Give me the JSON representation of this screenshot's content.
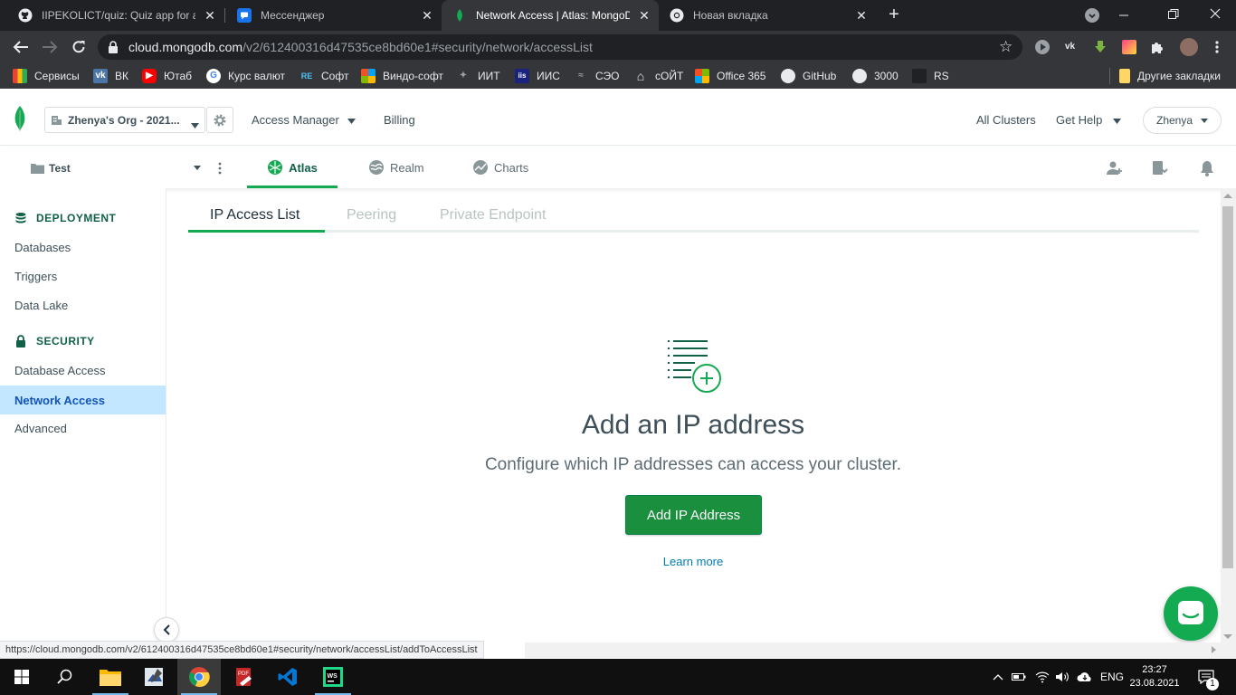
{
  "browser": {
    "tabs": [
      {
        "title": "IIPEKOLICT/quiz: Quiz app for and",
        "icon": "github-icon"
      },
      {
        "title": "Мессенджер",
        "icon": "messenger-icon"
      },
      {
        "title": "Network Access | Atlas: MongoDB",
        "icon": "mongodb-leaf-icon",
        "active": true
      },
      {
        "title": "Новая вкладка",
        "icon": "chrome-icon"
      }
    ],
    "url_host": "cloud.mongodb.com",
    "url_path": "/v2/612400316d47535ce8bd60e1#security/network/accessList",
    "bookmarks": [
      "Сервисы",
      "ВК",
      "Ютаб",
      "Курс валют",
      "Софт",
      "Виндо-софт",
      "ИИТ",
      "ИИС",
      "СЭО",
      "сОЙТ",
      "Office 365",
      "GitHub",
      "3000",
      "RS"
    ],
    "other_bookmarks": "Другие закладки"
  },
  "atlas": {
    "org": "Zhenya's Org - 2021...",
    "access_manager": "Access Manager",
    "billing": "Billing",
    "all_clusters": "All Clusters",
    "get_help": "Get Help",
    "user": "Zhenya",
    "project": "Test",
    "product_tabs": [
      "Atlas",
      "Realm",
      "Charts"
    ]
  },
  "sidebar": {
    "deployment": "DEPLOYMENT",
    "deployment_items": [
      "Databases",
      "Triggers",
      "Data Lake"
    ],
    "security": "SECURITY",
    "security_items": [
      "Database Access",
      "Network Access",
      "Advanced"
    ]
  },
  "main": {
    "subtabs": [
      "IP Access List",
      "Peering",
      "Private Endpoint"
    ],
    "empty_title": "Add an IP address",
    "empty_desc": "Configure which IP addresses can access your cluster.",
    "add_button": "Add IP Address",
    "learn_more": "Learn more"
  },
  "status_url": "https://cloud.mongodb.com/v2/612400316d47535ce8bd60e1#security/network/accessList/addToAccessList",
  "taskbar": {
    "lang": "ENG",
    "time": "23:27",
    "date": "23.08.2021",
    "notif_count": "1"
  },
  "colors": {
    "accent": "#13aa52",
    "link": "#007cad",
    "sidebar_active": "#c3e7fe"
  }
}
